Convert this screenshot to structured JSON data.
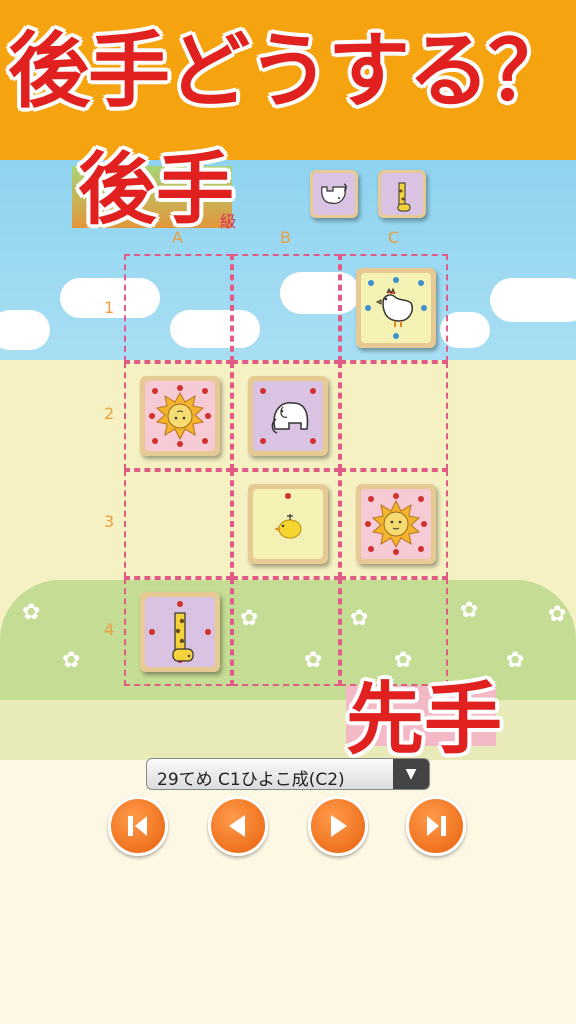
{
  "banner": {
    "title": "後手どうする？"
  },
  "labels": {
    "gote": "後手",
    "sente": "先手",
    "gote_rank": "級"
  },
  "board": {
    "columns": [
      "A",
      "B",
      "C"
    ],
    "rows": [
      "1",
      "2",
      "3",
      "4"
    ]
  },
  "pieces": [
    {
      "name": "niwatori",
      "cell": "C1",
      "icon": "chicken-icon",
      "owner": "sente"
    },
    {
      "name": "lion",
      "cell": "A2",
      "icon": "lion-icon",
      "owner": "gote"
    },
    {
      "name": "zou",
      "cell": "B2",
      "icon": "elephant-icon",
      "owner": "gote"
    },
    {
      "name": "hiyoko",
      "cell": "B3",
      "icon": "chick-icon",
      "owner": "sente"
    },
    {
      "name": "lion",
      "cell": "C3",
      "icon": "lion-icon",
      "owner": "sente"
    },
    {
      "name": "kirin",
      "cell": "A4",
      "icon": "giraffe-icon",
      "owner": "gote"
    }
  ],
  "captured_gote": [
    {
      "icon": "elephant-icon"
    },
    {
      "icon": "giraffe-icon"
    }
  ],
  "move_select": {
    "value": "29てめ C1ひよこ成(C2)"
  },
  "nav": [
    "first-move",
    "previous-move",
    "next-move",
    "last-move"
  ],
  "colors": {
    "accent": "#e1211f",
    "banner": "#f5a30f",
    "button": "#e8620d"
  }
}
